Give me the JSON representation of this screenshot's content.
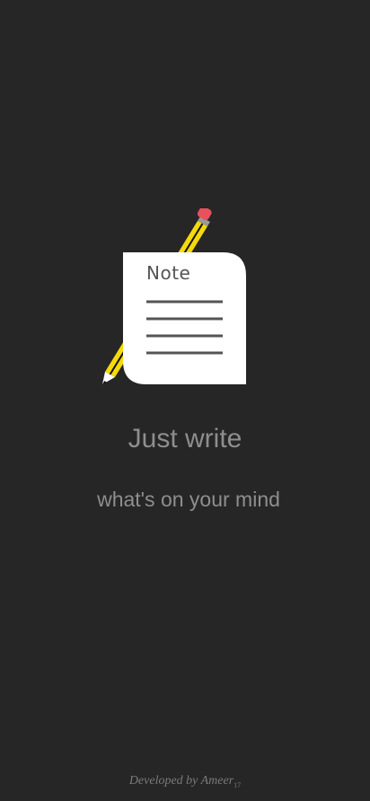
{
  "logo": {
    "note_label": "Note",
    "icon": "note-with-pencil-icon",
    "colors": {
      "paper": "#ffffff",
      "lines": "#555555",
      "pencil_body": "#f5d90a",
      "pencil_stripe": "#111111",
      "eraser": "#e8505b",
      "ferrule": "#9a9a9a"
    }
  },
  "splash": {
    "headline": "Just write",
    "subline": "what's on your mind"
  },
  "footer": {
    "credit": "Developed by Ameer",
    "credit_suffix": "17"
  },
  "theme": {
    "background": "#262626",
    "text": "#8e8e8e"
  }
}
